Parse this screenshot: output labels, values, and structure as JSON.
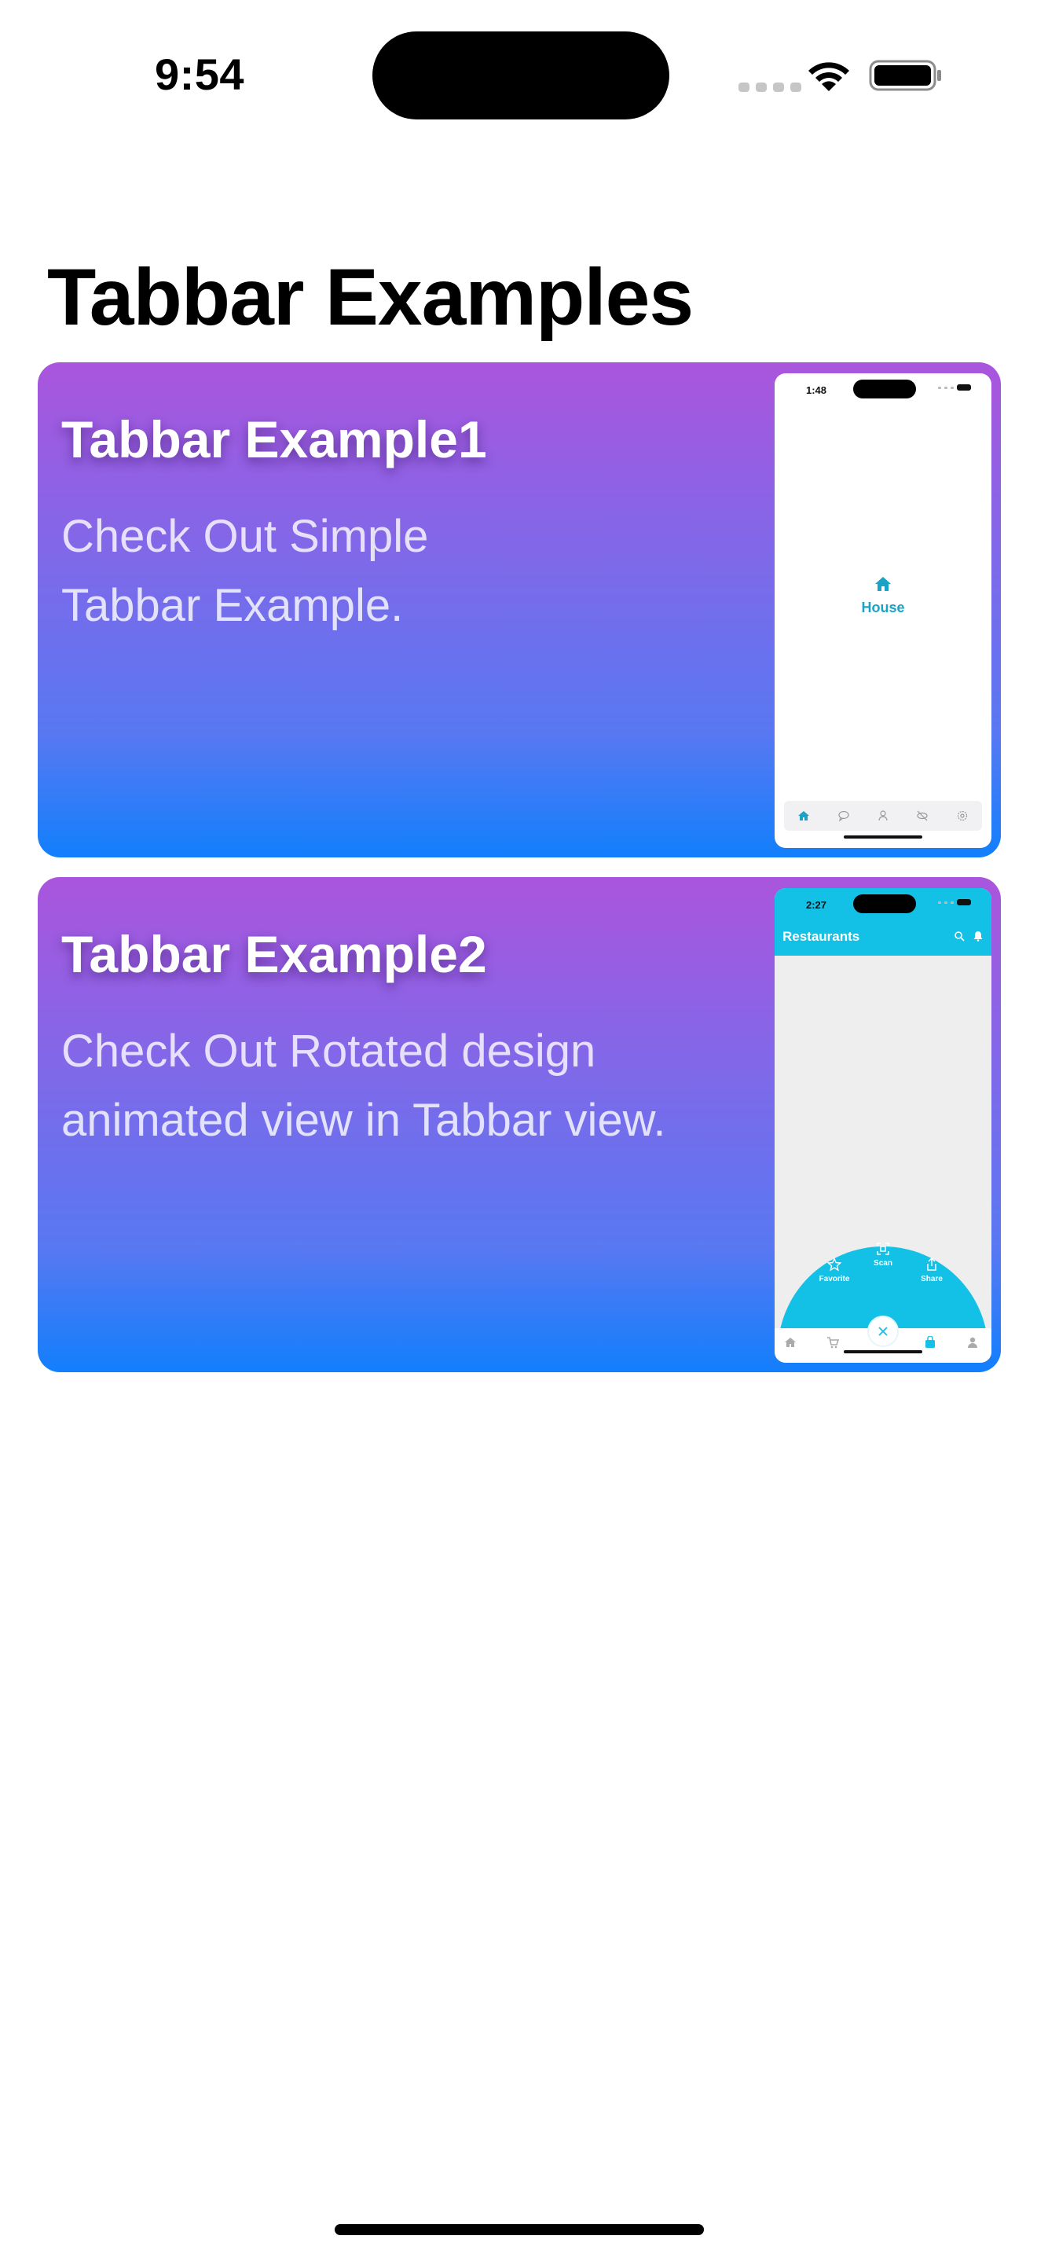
{
  "status_bar": {
    "time": "9:54"
  },
  "page": {
    "title": "Tabbar Examples"
  },
  "cards": [
    {
      "title": "Tabbar Example1",
      "description": "Check Out Simple Tabbar Example.",
      "preview": {
        "time": "1:48",
        "center_label": "House",
        "tabs": [
          "house-icon",
          "chat-bubble-icon",
          "person-icon",
          "eye-slash-icon",
          "gear-icon"
        ],
        "accent_color": "#1aa3c6"
      }
    },
    {
      "title": "Tabbar Example2",
      "description": "Check Out Rotated design animated view in Tabbar view.",
      "preview": {
        "time": "2:27",
        "header_title": "Restaurants",
        "fan_items": [
          "Favorite",
          "Scan",
          "Share"
        ],
        "bottom_tabs": [
          "home-icon",
          "cart-icon",
          "close-icon",
          "bag-icon",
          "person-icon"
        ],
        "accent_color": "#13c0e6"
      }
    }
  ],
  "colors": {
    "card_gradient_top": "#aa55dd",
    "card_gradient_bottom": "#127ffc"
  }
}
